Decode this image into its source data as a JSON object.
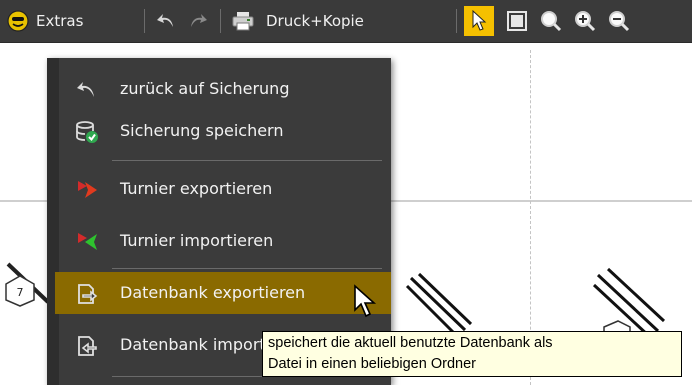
{
  "toolbar": {
    "extras_label": "Extras",
    "druck_label": "Druck+Kopie",
    "icons": [
      "smiley-icon",
      "undo-icon",
      "redo-icon",
      "printer-icon",
      "pointer-icon",
      "frame-icon",
      "zoom-icon",
      "zoom-in-icon",
      "zoom-out-icon"
    ],
    "active_color": "#f5c000"
  },
  "menu": {
    "items": [
      {
        "label": "zurück auf Sicherung",
        "icon": "undo-icon"
      },
      {
        "label": "Sicherung speichern",
        "icon": "database-save-icon"
      },
      {
        "label": "Turnier exportieren",
        "icon": "flag-export-icon"
      },
      {
        "label": "Turnier importieren",
        "icon": "flag-import-icon"
      },
      {
        "label": "Datenbank exportieren",
        "icon": "export-icon"
      },
      {
        "label": "Datenbank importieren",
        "icon": "import-icon"
      }
    ],
    "highlight_color": "#8a6a00"
  },
  "tooltip": {
    "line1": "speichert die aktuell benutzte Datenbank als",
    "line2": "Datei in einen beliebigen Ordner"
  },
  "background": {
    "node_label": "7"
  }
}
